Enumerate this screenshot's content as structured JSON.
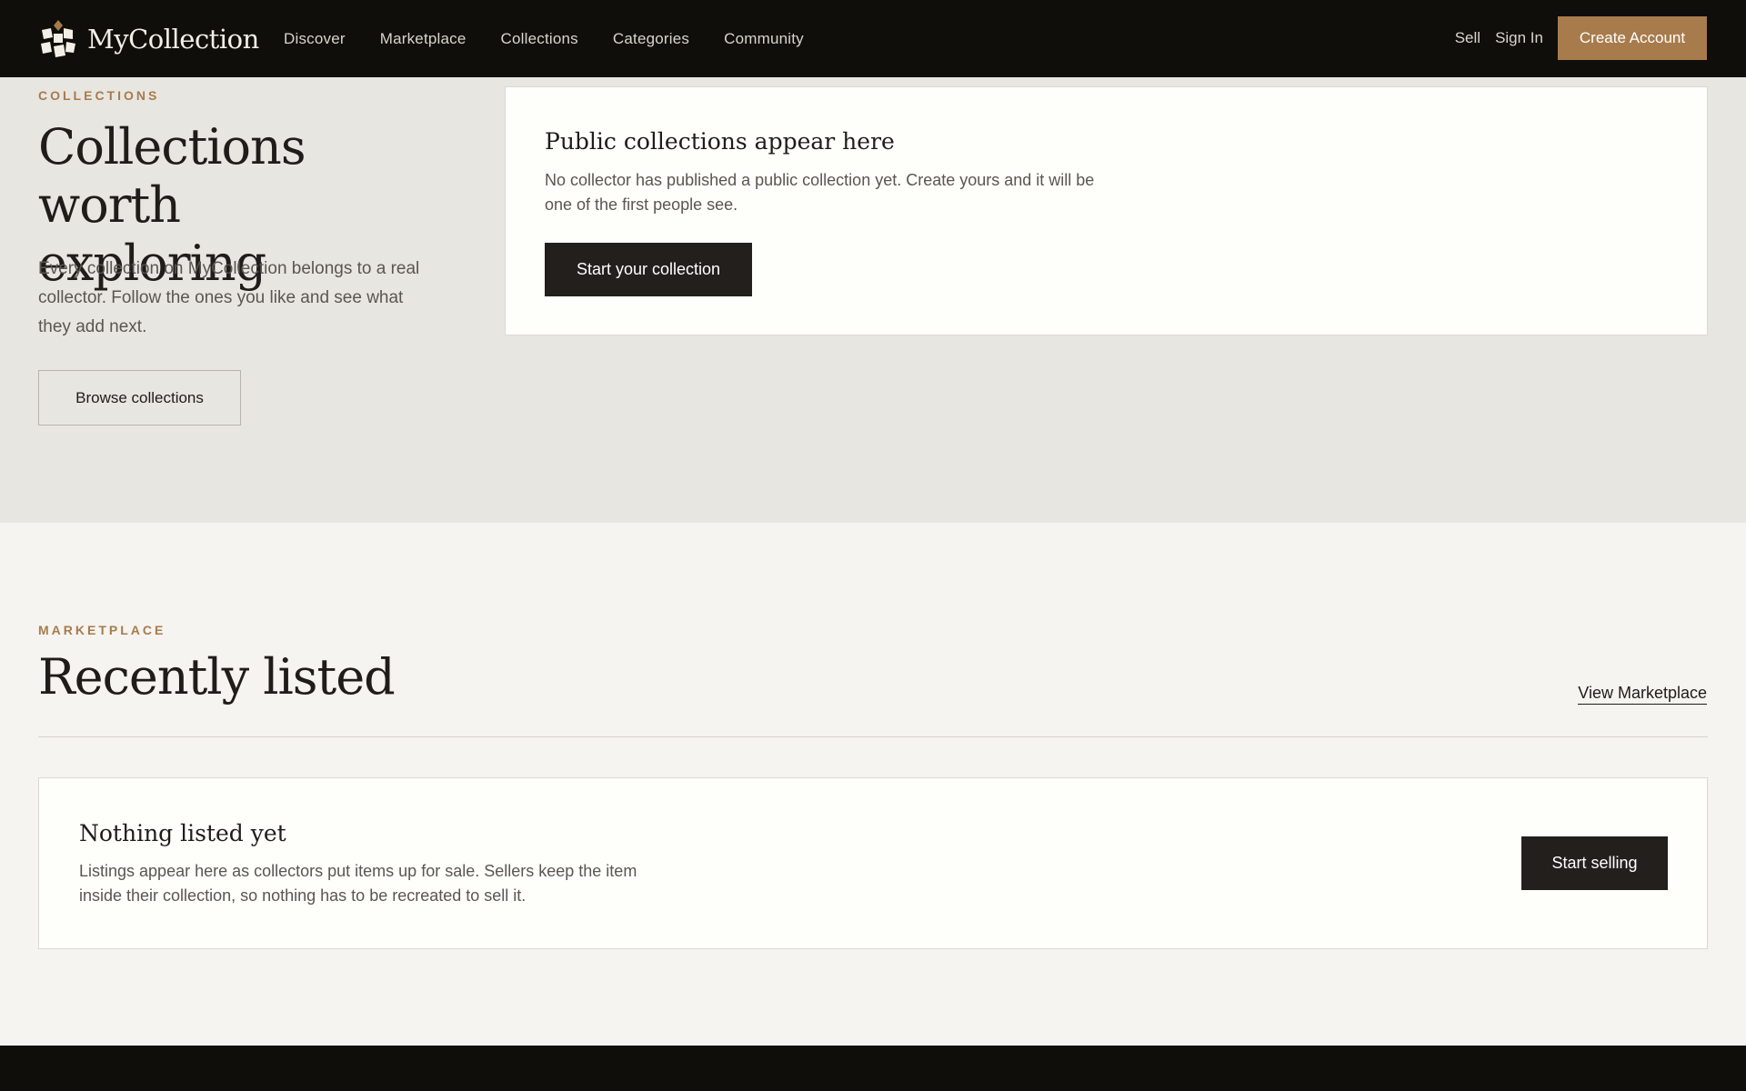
{
  "header": {
    "brand": "MyCollection",
    "nav": [
      "Discover",
      "Marketplace",
      "Collections",
      "Categories",
      "Community"
    ],
    "sell": "Sell",
    "sign_in": "Sign In",
    "create_account": "Create Account"
  },
  "hero": {
    "eyebrow": "COLLECTIONS",
    "title": "Collections worth exploring",
    "description": "Every collection on MyCollection belongs to a real collector. Follow the ones you like and see what they add next.",
    "browse_button": "Browse collections",
    "panel": {
      "title": "Public collections appear here",
      "text": "No collector has published a public collection yet. Create yours and it will be one of the first people see.",
      "button": "Start your collection"
    }
  },
  "marketplace": {
    "eyebrow": "MARKETPLACE",
    "title": "Recently listed",
    "view_link": "View Marketplace",
    "empty": {
      "title": "Nothing listed yet",
      "text": "Listings appear here as collectors put items up for sale. Sellers keep the item inside their collection, so nothing has to be recreated to sell it.",
      "button": "Start selling"
    }
  },
  "colors": {
    "accent": "#a87b4c",
    "dark": "#0f0e0b",
    "button_dark": "#231f1d",
    "hero_bg": "#e8e6e1",
    "page_bg": "#f5f4f0"
  }
}
